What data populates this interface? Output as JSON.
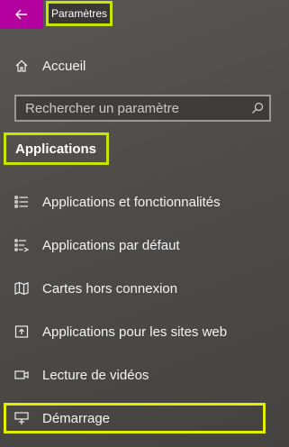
{
  "window": {
    "title": "Paramètres"
  },
  "nav": {
    "home_label": "Accueil",
    "search_placeholder": "Rechercher un paramètre",
    "section_heading": "Applications",
    "items": [
      {
        "label": "Applications et fonctionnalités",
        "icon": "apps-features-icon"
      },
      {
        "label": "Applications par défaut",
        "icon": "default-apps-icon"
      },
      {
        "label": "Cartes hors connexion",
        "icon": "offline-maps-icon"
      },
      {
        "label": "Applications pour les sites web",
        "icon": "apps-for-websites-icon"
      },
      {
        "label": "Lecture de vidéos",
        "icon": "video-playback-icon"
      },
      {
        "label": "Démarrage",
        "icon": "startup-icon"
      }
    ]
  },
  "colors": {
    "accent": "#b4009e",
    "highlight": "#c5e600",
    "background": "#4e4b49"
  }
}
